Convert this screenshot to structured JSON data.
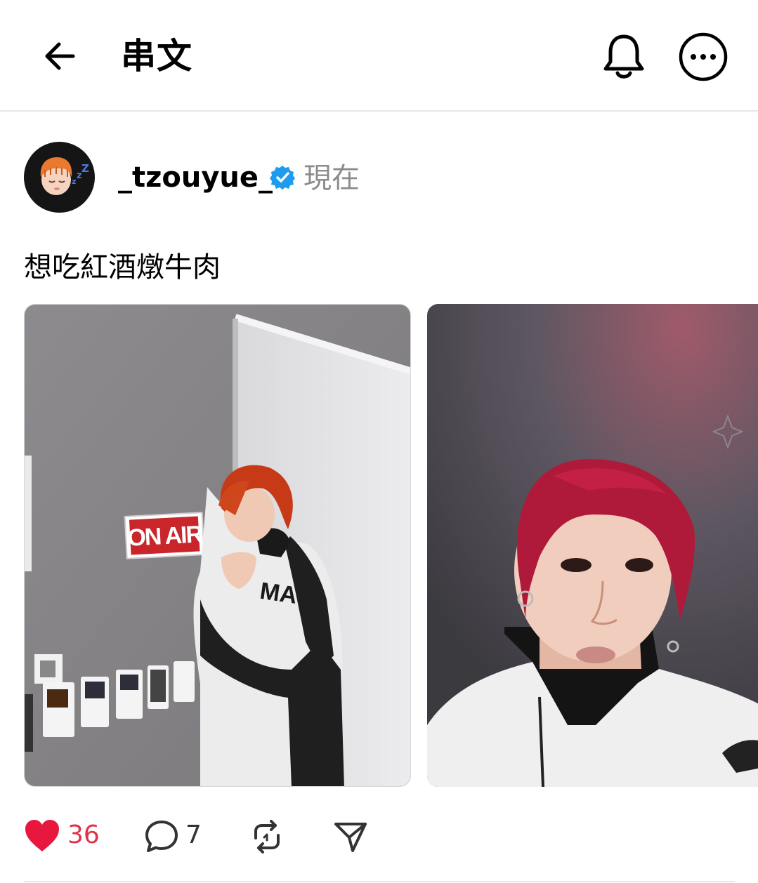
{
  "header": {
    "title": "串文",
    "back_icon": "arrow-left-icon",
    "bell_icon": "bell-icon",
    "more_icon": "more-horizontal-icon"
  },
  "post": {
    "username": "_tzouyue_",
    "verified": true,
    "verified_color": "#1d9bf0",
    "timestamp": "現在",
    "text": "想吃紅酒燉牛肉",
    "photo_1": {
      "sign": "ON AIR",
      "jacket_text": "MA"
    },
    "likes": "36",
    "liked": true,
    "like_color": "#e0314b",
    "comments": "7"
  }
}
